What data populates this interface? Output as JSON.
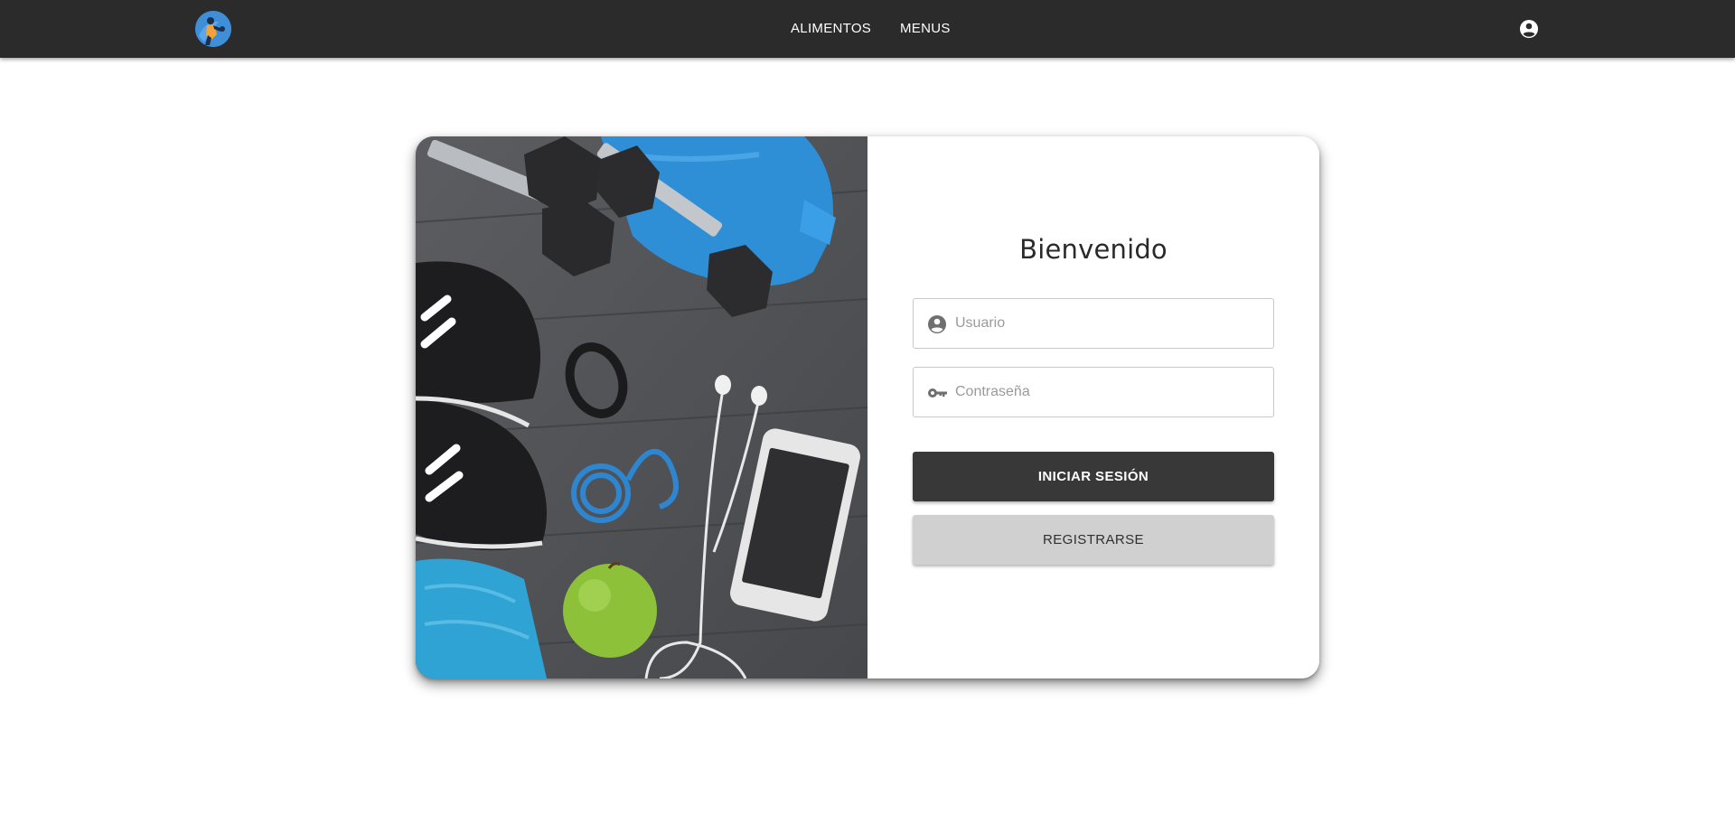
{
  "header": {
    "logo_icon": "app-logo-icon",
    "nav": [
      {
        "label": "ALIMENTOS"
      },
      {
        "label": "MENUS"
      }
    ],
    "account_icon": "account-circle-icon"
  },
  "hero": {
    "image_subject": "fitness-equipment-photo"
  },
  "login": {
    "title": "Bienvenido",
    "username": {
      "placeholder": "Usuario",
      "value": "",
      "icon": "account-circle-icon"
    },
    "password": {
      "placeholder": "Contraseña",
      "value": "",
      "icon": "key-icon"
    },
    "submit_label": "INICIAR SESIÓN",
    "register_label": "REGISTRARSE"
  },
  "colors": {
    "topbar": "#2b2b2b",
    "primary_button": "#383838",
    "secondary_button": "#d0d0d0"
  }
}
